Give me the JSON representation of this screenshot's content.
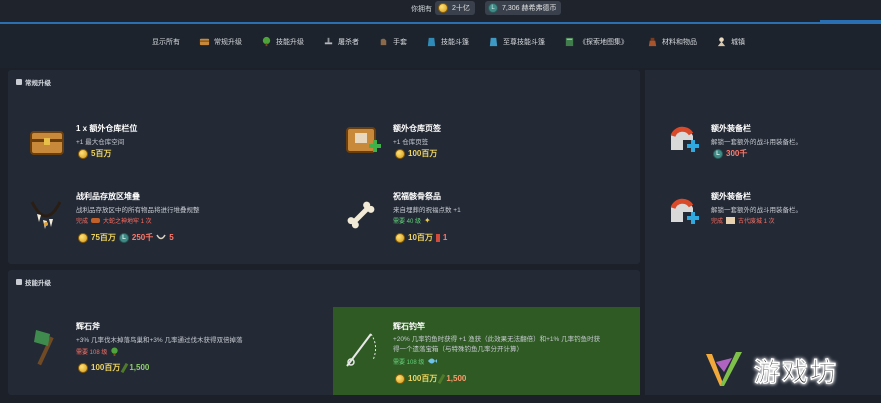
{
  "header": {
    "owned_label": "你拥有",
    "gold_amount": "2十亿",
    "mesh_amount": "7,306 赫希弗德币"
  },
  "filters": [
    {
      "label": "显示所有",
      "icon": "none"
    },
    {
      "label": "常规升级",
      "icon": "chest-icon"
    },
    {
      "label": "技能升级",
      "icon": "tree-icon"
    },
    {
      "label": "屠杀者",
      "icon": "anvil-icon"
    },
    {
      "label": "手套",
      "icon": "glove-icon"
    },
    {
      "label": "技能斗篷",
      "icon": "cape-icon"
    },
    {
      "label": "至尊技能斗篷",
      "icon": "cape-icon"
    },
    {
      "label": "《探索地图集》",
      "icon": "book-icon"
    },
    {
      "label": "材料和物品",
      "icon": "bag-icon"
    },
    {
      "label": "城镇",
      "icon": "town-icon"
    }
  ],
  "sections": {
    "general": "常规升级",
    "skills": "技能升级"
  },
  "items": {
    "bank_slot": {
      "name": "1 x 额外仓库栏位",
      "desc": "+1 最大仓库空间",
      "price": "5百万"
    },
    "bank_tab": {
      "name": "额外仓库页签",
      "desc": "+1 仓库页签",
      "price": "100百万"
    },
    "equip_slot_1": {
      "name": "额外装备栏",
      "desc": "解锁一套额外的战斗用装备栏。",
      "price": "300千"
    },
    "loot_stack": {
      "name": "战利品存放区堆叠",
      "desc": "战利品存放区中的所有物品将进行堆叠规整",
      "req_label": "完成",
      "req_item": "大蛇之神地牢 1 次",
      "price_gold": "75百万",
      "price_mesh": "250千",
      "price_other": "5"
    },
    "bone_offering": {
      "name": "祝福骸骨祭品",
      "desc": "来自埋葬的祝福点数 +1",
      "req_label": "需要 40 级",
      "price_gold": "10百万",
      "price_other": "1"
    },
    "equip_slot_2": {
      "name": "额外装备栏",
      "desc": "解锁一套额外的战斗用装备栏。",
      "req_label": "完成",
      "req_item": "古代废城 1 次"
    },
    "axe": {
      "name": "辉石斧",
      "desc": "+3% 几率伐木掉落鸟巢和+3% 几率通过伐木获得双倍掉落",
      "req_label": "需要 108 级",
      "price_gold": "100百万",
      "price_other": "1,500"
    },
    "rod": {
      "name": "辉石钓竿",
      "desc_1": "+20% 几率钓鱼时获得 +1 渔获（此效果无法翻倍）和+1% 几率钓鱼时获",
      "desc_2": "得一个遗落宝箱（与特殊钓鱼几率分开计算）",
      "req_label": "需要 108 级",
      "price_gold": "100百万",
      "price_other": "1,500"
    }
  },
  "watermark": {
    "text": "游戏坊"
  }
}
